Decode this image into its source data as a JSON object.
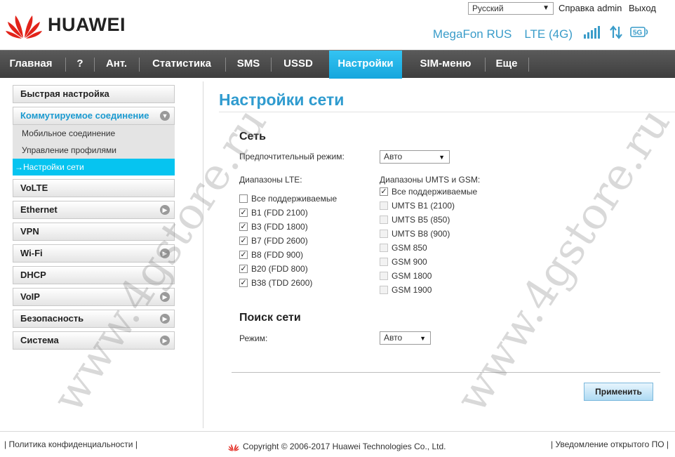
{
  "header": {
    "brand": "HUAWEI",
    "language": "Русский",
    "links": {
      "help": "Справка",
      "user": "admin",
      "logout": "Выход"
    },
    "operator": "MegaFon RUS",
    "network_type": "LTE (4G)",
    "badge_5g": "5G"
  },
  "nav": {
    "items": [
      {
        "label": "Главная"
      },
      {
        "label": "?"
      },
      {
        "label": "Ант."
      },
      {
        "label": "Статистика"
      },
      {
        "label": "SMS"
      },
      {
        "label": "USSD"
      },
      {
        "label": "Настройки"
      },
      {
        "label": "SIM-меню"
      },
      {
        "label": "Еще"
      }
    ],
    "active": "Настройки"
  },
  "sidebar": {
    "quick_setup": "Быстрая настройка",
    "dialup": "Коммутируемое соединение",
    "subitems": [
      {
        "label": "Мобильное соединение"
      },
      {
        "label": "Управление профилями"
      },
      {
        "label": "→Настройки сети"
      }
    ],
    "items": [
      {
        "label": "VoLTE"
      },
      {
        "label": "Ethernet"
      },
      {
        "label": "VPN"
      },
      {
        "label": "Wi-Fi"
      },
      {
        "label": "DHCP"
      },
      {
        "label": "VoIP"
      },
      {
        "label": "Безопасность"
      },
      {
        "label": "Система"
      }
    ]
  },
  "main": {
    "title": "Настройки сети",
    "network": {
      "heading": "Сеть",
      "pref_mode_label": "Предпочтительный режим:",
      "pref_mode_value": "Авто",
      "lte_label": "Диапазоны LTE:",
      "lte_bands": [
        {
          "label": "Все поддерживаемые",
          "checked": false
        },
        {
          "label": "B1 (FDD 2100)",
          "checked": true
        },
        {
          "label": "B3 (FDD 1800)",
          "checked": true
        },
        {
          "label": "B7 (FDD 2600)",
          "checked": true
        },
        {
          "label": "B8 (FDD 900)",
          "checked": true
        },
        {
          "label": "B20 (FDD 800)",
          "checked": true
        },
        {
          "label": "B38 (TDD 2600)",
          "checked": true
        }
      ],
      "umts_label": "Диапазоны UMTS и GSM:",
      "umts_bands": [
        {
          "label": "Все поддерживаемые",
          "checked": true,
          "disabled": false
        },
        {
          "label": "UMTS B1 (2100)",
          "checked": false,
          "disabled": true
        },
        {
          "label": "UMTS B5 (850)",
          "checked": false,
          "disabled": true
        },
        {
          "label": "UMTS B8 (900)",
          "checked": false,
          "disabled": true
        },
        {
          "label": "GSM 850",
          "checked": false,
          "disabled": true
        },
        {
          "label": "GSM 900",
          "checked": false,
          "disabled": true
        },
        {
          "label": "GSM 1800",
          "checked": false,
          "disabled": true
        },
        {
          "label": "GSM 1900",
          "checked": false,
          "disabled": true
        }
      ]
    },
    "search": {
      "heading": "Поиск сети",
      "mode_label": "Режим:",
      "mode_value": "Авто"
    },
    "apply": "Применить"
  },
  "footer": {
    "privacy": "Политика конфиденциальности",
    "copyright": "Copyright © 2006-2017 Huawei Technologies Co., Ltd.",
    "notice": "Уведомление открытого ПО"
  },
  "watermark": "www.4gstore.ru",
  "colors": {
    "accent": "#2f9bcf",
    "active_nav": "#1aa9e0",
    "active_sub": "#06c4f0"
  }
}
